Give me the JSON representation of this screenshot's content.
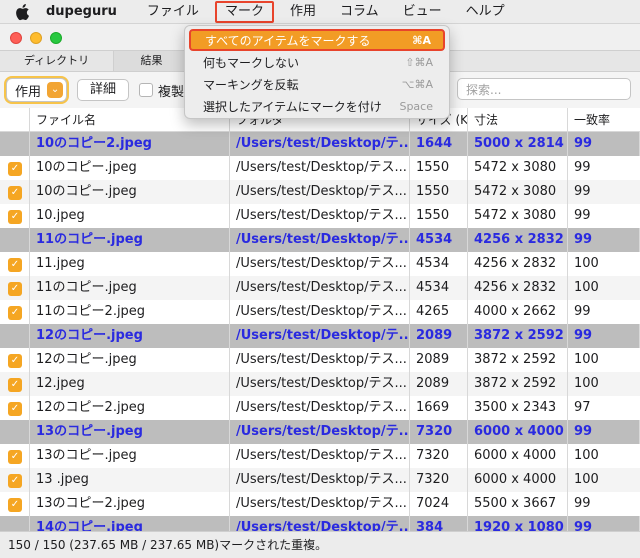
{
  "menubar": {
    "app_name": "dupeguru",
    "items": [
      "ファイル",
      "マーク",
      "作用",
      "コラム",
      "ビュー",
      "ヘルプ"
    ]
  },
  "dropdown": {
    "items": [
      {
        "label": "すべてのアイテムをマークする",
        "shortcut": "⌘A"
      },
      {
        "label": "何もマークしない",
        "shortcut": "⇧⌘A"
      },
      {
        "label": "マーキングを反転",
        "shortcut": "⌥⌘A"
      },
      {
        "label": "選択したアイテムにマークを付け",
        "shortcut": "Space"
      }
    ]
  },
  "tabs": [
    "ディレクトリ",
    "結果"
  ],
  "toolbar": {
    "action_label": "作用",
    "detail_label": "詳細",
    "dupes_label": "複製",
    "search_placeholder": "探索..."
  },
  "table": {
    "headers": [
      "",
      "ファイル名",
      "フォルダ",
      "サイズ (KB)",
      "寸法",
      "一致率"
    ],
    "rows": [
      {
        "ref": true,
        "checked": false,
        "name": "10のコピー2.jpeg",
        "folder": "/Users/test/Desktop/テ...",
        "size": "1644",
        "dim": "5000 x 2814",
        "match": "99"
      },
      {
        "ref": false,
        "checked": true,
        "name": "10のコピー.jpeg",
        "folder": "/Users/test/Desktop/テス...",
        "size": "1550",
        "dim": "5472 x 3080",
        "match": "99"
      },
      {
        "ref": false,
        "checked": true,
        "name": "10のコピー.jpeg",
        "folder": "/Users/test/Desktop/テス...",
        "size": "1550",
        "dim": "5472 x 3080",
        "match": "99"
      },
      {
        "ref": false,
        "checked": true,
        "name": "10.jpeg",
        "folder": "/Users/test/Desktop/テス...",
        "size": "1550",
        "dim": "5472 x 3080",
        "match": "99"
      },
      {
        "ref": true,
        "checked": false,
        "name": "11のコピー.jpeg",
        "folder": "/Users/test/Desktop/テ...",
        "size": "4534",
        "dim": "4256 x 2832",
        "match": "99"
      },
      {
        "ref": false,
        "checked": true,
        "name": "11.jpeg",
        "folder": "/Users/test/Desktop/テス...",
        "size": "4534",
        "dim": "4256 x 2832",
        "match": "100"
      },
      {
        "ref": false,
        "checked": true,
        "name": "11のコピー.jpeg",
        "folder": "/Users/test/Desktop/テス...",
        "size": "4534",
        "dim": "4256 x 2832",
        "match": "100"
      },
      {
        "ref": false,
        "checked": true,
        "name": "11のコピー2.jpeg",
        "folder": "/Users/test/Desktop/テス...",
        "size": "4265",
        "dim": "4000 x 2662",
        "match": "99"
      },
      {
        "ref": true,
        "checked": false,
        "name": "12のコピー.jpeg",
        "folder": "/Users/test/Desktop/テ...",
        "size": "2089",
        "dim": "3872 x 2592",
        "match": "99"
      },
      {
        "ref": false,
        "checked": true,
        "name": "12のコピー.jpeg",
        "folder": "/Users/test/Desktop/テス...",
        "size": "2089",
        "dim": "3872 x 2592",
        "match": "100"
      },
      {
        "ref": false,
        "checked": true,
        "name": "12.jpeg",
        "folder": "/Users/test/Desktop/テス...",
        "size": "2089",
        "dim": "3872 x 2592",
        "match": "100"
      },
      {
        "ref": false,
        "checked": true,
        "name": "12のコピー2.jpeg",
        "folder": "/Users/test/Desktop/テス...",
        "size": "1669",
        "dim": "3500 x 2343",
        "match": "97"
      },
      {
        "ref": true,
        "checked": false,
        "name": "13のコピー.jpeg",
        "folder": "/Users/test/Desktop/テ...",
        "size": "7320",
        "dim": "6000 x 4000",
        "match": "99"
      },
      {
        "ref": false,
        "checked": true,
        "name": "13のコピー.jpeg",
        "folder": "/Users/test/Desktop/テス...",
        "size": "7320",
        "dim": "6000 x 4000",
        "match": "100"
      },
      {
        "ref": false,
        "checked": true,
        "name": "13 .jpeg",
        "folder": "/Users/test/Desktop/テス...",
        "size": "7320",
        "dim": "6000 x 4000",
        "match": "100"
      },
      {
        "ref": false,
        "checked": true,
        "name": "13のコピー2.jpeg",
        "folder": "/Users/test/Desktop/テス...",
        "size": "7024",
        "dim": "5500 x 3667",
        "match": "99"
      },
      {
        "ref": true,
        "checked": false,
        "name": "14のコピー.jpeg",
        "folder": "/Users/test/Desktop/テ...",
        "size": "384",
        "dim": "1920 x 1080",
        "match": "99"
      }
    ]
  },
  "status": "150 / 150 (237.65 MB / 237.65 MB)マークされた重複。",
  "colors": {
    "accent": "#f5a623",
    "ref_row_text": "#2a2ae0",
    "ref_row_bg": "#bdbdbd",
    "highlight_border": "#e8442c"
  }
}
